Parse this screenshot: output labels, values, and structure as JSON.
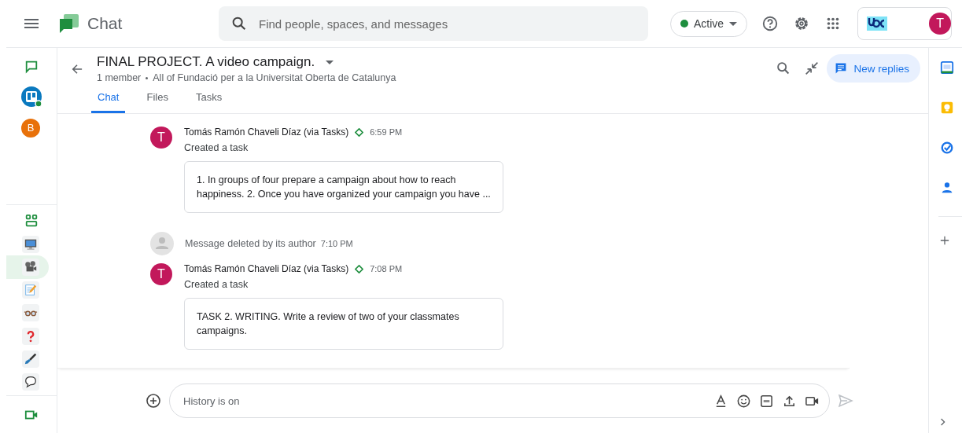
{
  "header": {
    "app_name": "Chat",
    "search": {
      "placeholder": "Find people, spaces, and messages"
    },
    "status": {
      "label": "Active",
      "online": true
    },
    "account_initial": "T"
  },
  "rail": {
    "top": [
      {
        "kind": "chat",
        "selected": false
      },
      {
        "kind": "board-avatar",
        "selected": false
      },
      {
        "kind": "letter-avatar",
        "initial": "B",
        "selected": false
      }
    ],
    "spaces": [
      {
        "kind": "spaces",
        "selected": false
      },
      {
        "kind": "monitor",
        "selected": false
      },
      {
        "kind": "projector",
        "selected": true
      },
      {
        "kind": "memo",
        "selected": false
      },
      {
        "kind": "glasses",
        "selected": false
      },
      {
        "kind": "question",
        "selected": false
      },
      {
        "kind": "pen",
        "selected": false
      },
      {
        "kind": "speech",
        "selected": false
      }
    ],
    "bottom": [
      {
        "kind": "video",
        "selected": false
      }
    ]
  },
  "space": {
    "title": "FINAL PROJECT. A video campaign.",
    "members": "1 member",
    "audience": "All of Fundació per a la Universitat Oberta de Catalunya",
    "tabs": [
      {
        "label": "Chat",
        "selected": true
      },
      {
        "label": "Files",
        "selected": false
      },
      {
        "label": "Tasks",
        "selected": false
      }
    ],
    "new_replies": "New replies"
  },
  "messages": [
    {
      "kind": "task",
      "initial": "T",
      "author": "Tomás Ramón Chaveli Díaz (via Tasks)",
      "time": "6:59 PM",
      "action": "Created a task",
      "card": "1. In groups of four prepare a campaign about how to reach happiness. 2. Once you have organized your campaign you have ..."
    },
    {
      "kind": "deleted",
      "text": "Message deleted by its author",
      "time": "7:10 PM"
    },
    {
      "kind": "task",
      "initial": "T",
      "author": "Tomás Ramón Chaveli Díaz (via Tasks)",
      "time": "7:08 PM",
      "action": "Created a task",
      "card": "TASK 2. WRITING. Write a review of two of your classmates campaigns."
    }
  ],
  "composer": {
    "placeholder": "History is on"
  }
}
